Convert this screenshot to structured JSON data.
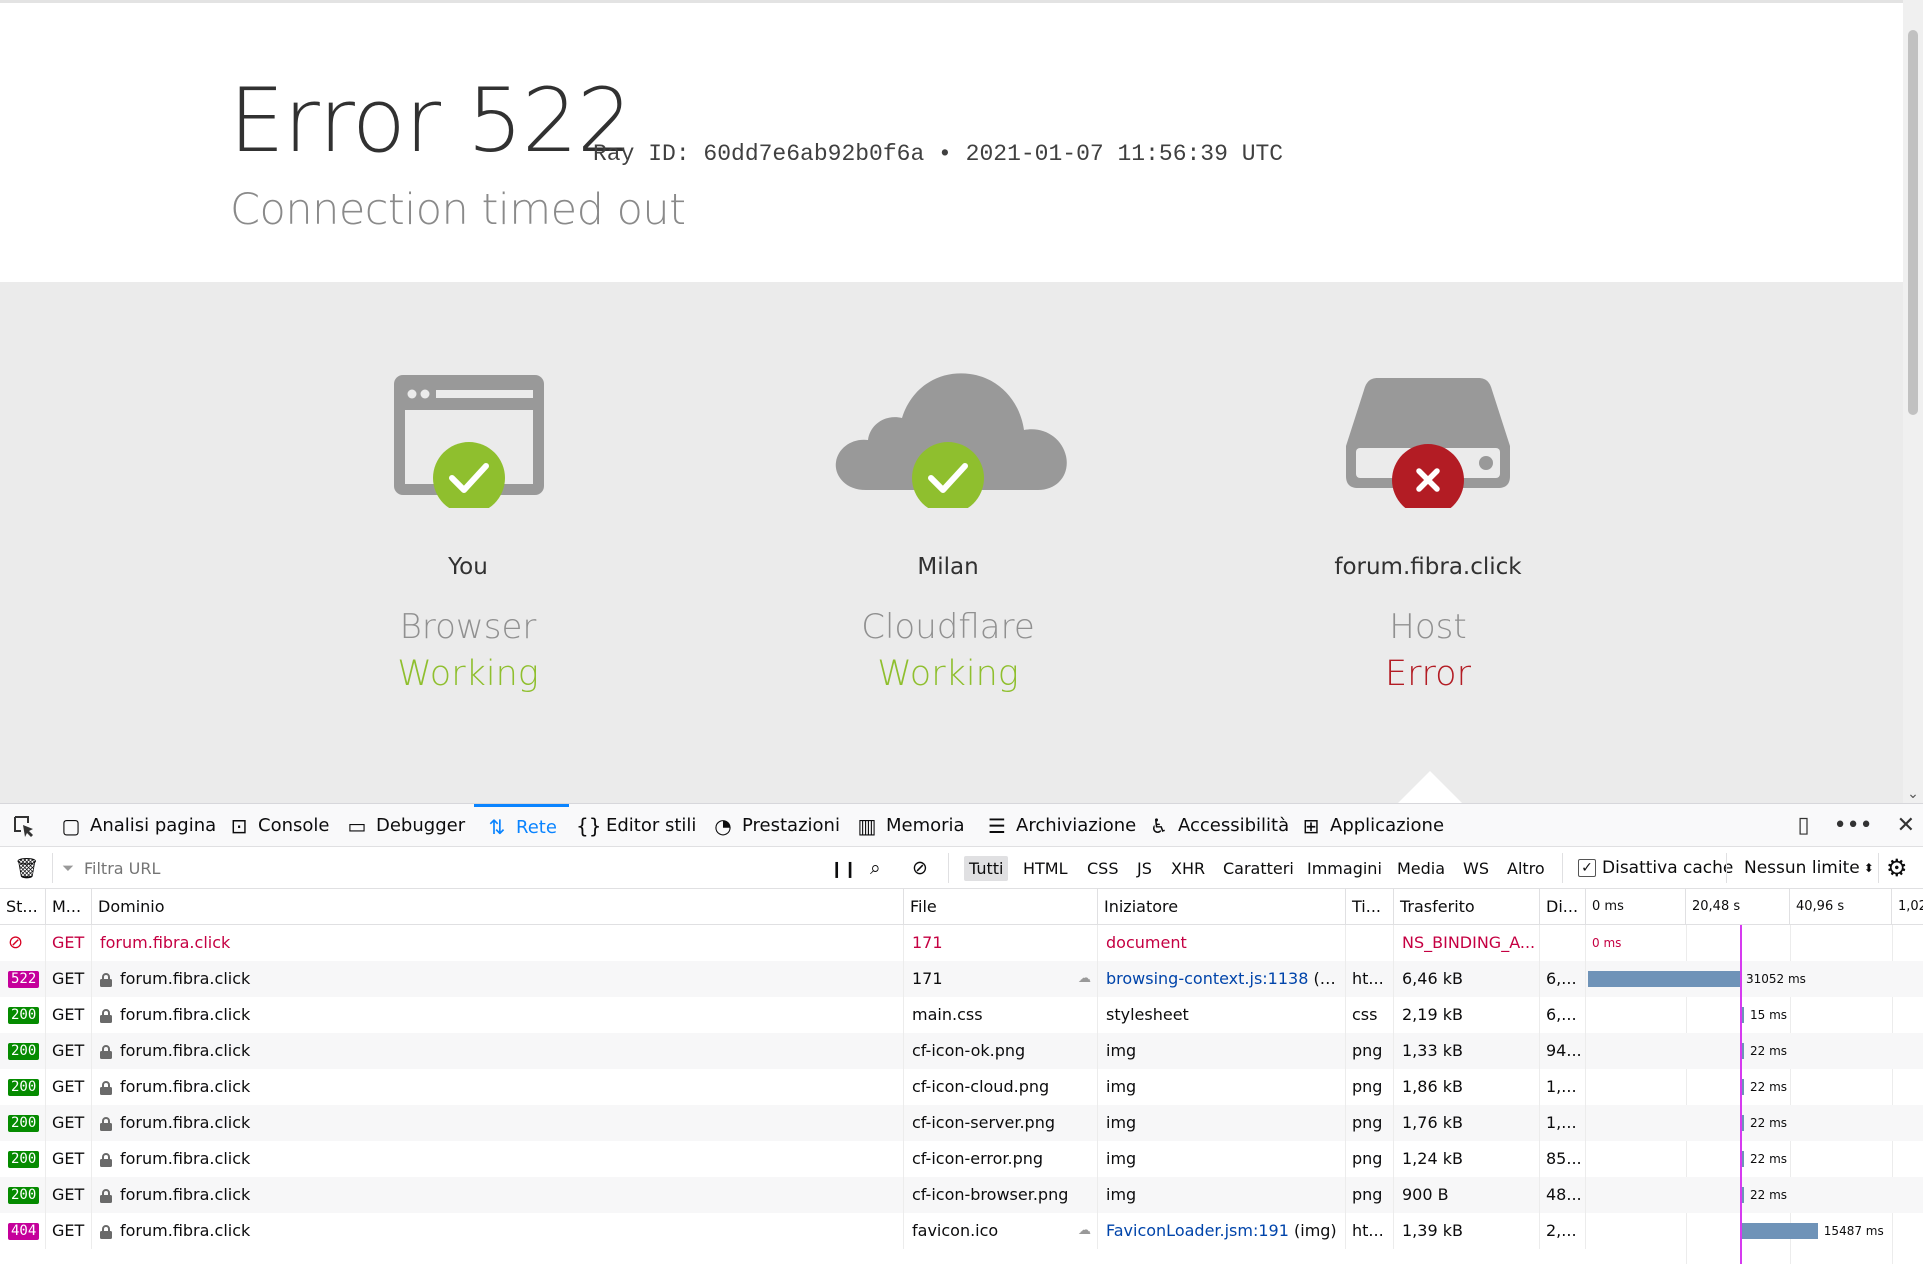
{
  "error": {
    "title": "Error 522",
    "ray": "Ray ID: 60dd7e6ab92b0f6a • 2021-01-07 11:56:39 UTC",
    "subtitle": "Connection timed out"
  },
  "diagram": [
    {
      "location": "You",
      "kind": "Browser",
      "status": "Working",
      "status_color": "#8fbf2e",
      "icon": "browser-icon"
    },
    {
      "location": "Milan",
      "kind": "Cloudflare",
      "status": "Working",
      "status_color": "#8fbf2e",
      "icon": "cloud-icon"
    },
    {
      "location": "forum.fibra.click",
      "kind": "Host",
      "status": "Error",
      "status_color": "#b31c24",
      "icon": "server-icon"
    }
  ],
  "devtools": {
    "tabs": [
      {
        "label": "Analisi pagina",
        "icon": "inspector-icon"
      },
      {
        "label": "Console",
        "icon": "console-icon"
      },
      {
        "label": "Debugger",
        "icon": "debugger-icon"
      },
      {
        "label": "Rete",
        "icon": "network-icon",
        "active": true
      },
      {
        "label": "Editor stili",
        "icon": "style-editor-icon"
      },
      {
        "label": "Prestazioni",
        "icon": "performance-icon"
      },
      {
        "label": "Memoria",
        "icon": "memory-icon"
      },
      {
        "label": "Archiviazione",
        "icon": "storage-icon"
      },
      {
        "label": "Accessibilità",
        "icon": "accessibility-icon"
      },
      {
        "label": "Applicazione",
        "icon": "application-icon"
      }
    ],
    "toolbar": {
      "filter_placeholder": "Filtra URL",
      "types": [
        "Tutti",
        "HTML",
        "CSS",
        "JS",
        "XHR",
        "Caratteri",
        "Immagini",
        "Media",
        "WS",
        "Altro"
      ],
      "selected_type": "Tutti",
      "disable_cache_label": "Disattiva cache",
      "disable_cache_checked": true,
      "throttle_label": "Nessun limite"
    },
    "columns": [
      "St...",
      "M...",
      "Dominio",
      "File",
      "Iniziatore",
      "Ti...",
      "Trasferito",
      "Di..."
    ],
    "timeline_ticks": [
      "0 ms",
      "20,48 s",
      "40,96 s",
      "1,02"
    ],
    "requests": [
      {
        "status": "",
        "blocked": true,
        "method": "GET",
        "domain": "forum.fibra.click",
        "file": "171",
        "initiator": "document",
        "initiator_link": "",
        "type": "",
        "transferred": "NS_BINDING_A...",
        "size": "",
        "time_label": "0 ms",
        "error": true
      },
      {
        "status": "522",
        "status_color": "#c5009b",
        "method": "GET",
        "domain": "forum.fibra.click",
        "file": "171",
        "initiator": "(doc...",
        "initiator_link": "browsing-context.js:1138",
        "type": "ht...",
        "transferred": "6,46 kB",
        "size": "6,...",
        "time_label": "31052 ms",
        "ms": 31052
      },
      {
        "status": "200",
        "status_color": "#058b00",
        "method": "GET",
        "domain": "forum.fibra.click",
        "file": "main.css",
        "initiator": "stylesheet",
        "initiator_link": "",
        "type": "css",
        "transferred": "2,19 kB",
        "size": "6,...",
        "time_label": "15 ms",
        "ms": 15
      },
      {
        "status": "200",
        "status_color": "#058b00",
        "method": "GET",
        "domain": "forum.fibra.click",
        "file": "cf-icon-ok.png",
        "initiator": "img",
        "initiator_link": "",
        "type": "png",
        "transferred": "1,33 kB",
        "size": "94...",
        "time_label": "22 ms",
        "ms": 22
      },
      {
        "status": "200",
        "status_color": "#058b00",
        "method": "GET",
        "domain": "forum.fibra.click",
        "file": "cf-icon-cloud.png",
        "initiator": "img",
        "initiator_link": "",
        "type": "png",
        "transferred": "1,86 kB",
        "size": "1,...",
        "time_label": "22 ms",
        "ms": 22
      },
      {
        "status": "200",
        "status_color": "#058b00",
        "method": "GET",
        "domain": "forum.fibra.click",
        "file": "cf-icon-server.png",
        "initiator": "img",
        "initiator_link": "",
        "type": "png",
        "transferred": "1,76 kB",
        "size": "1,...",
        "time_label": "22 ms",
        "ms": 22
      },
      {
        "status": "200",
        "status_color": "#058b00",
        "method": "GET",
        "domain": "forum.fibra.click",
        "file": "cf-icon-error.png",
        "initiator": "img",
        "initiator_link": "",
        "type": "png",
        "transferred": "1,24 kB",
        "size": "85...",
        "time_label": "22 ms",
        "ms": 22
      },
      {
        "status": "200",
        "status_color": "#058b00",
        "method": "GET",
        "domain": "forum.fibra.click",
        "file": "cf-icon-browser.png",
        "initiator": "img",
        "initiator_link": "",
        "type": "png",
        "transferred": "900 B",
        "size": "48...",
        "time_label": "22 ms",
        "ms": 22
      },
      {
        "status": "404",
        "status_color": "#c5009b",
        "method": "GET",
        "domain": "forum.fibra.click",
        "file": "favicon.ico",
        "initiator": "(img)",
        "initiator_link": "FaviconLoader.jsm:191",
        "type": "ht...",
        "transferred": "1,39 kB",
        "size": "2,...",
        "time_label": "15487 ms",
        "ms": 15487
      }
    ]
  }
}
